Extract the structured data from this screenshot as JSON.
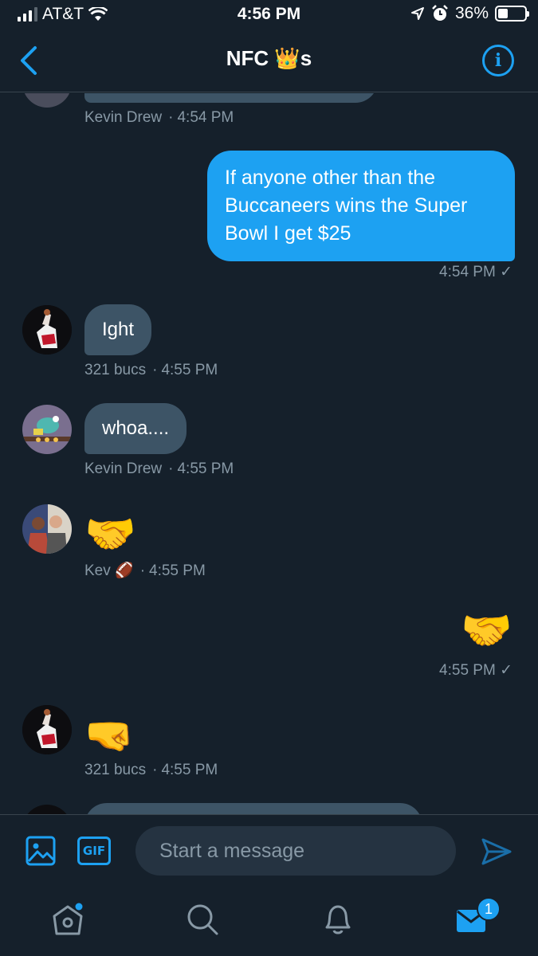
{
  "status_bar": {
    "carrier": "AT&T",
    "time": "4:56 PM",
    "battery": "36%",
    "battery_level": 0.36
  },
  "header": {
    "title": "NFC 👑s"
  },
  "messages": [
    {
      "author": "Kevin Drew",
      "time": "4:54 PM"
    },
    {
      "text": "If anyone other than the Buccaneers wins the Super Bowl I get $25",
      "time": "4:54 PM ✓"
    },
    {
      "text": "Ight",
      "author": "321 bucs",
      "time": "4:55 PM"
    },
    {
      "text": "whoa....",
      "author": "Kevin Drew",
      "time": "4:55 PM"
    },
    {
      "emoji": "🤝",
      "author": "Kev 🏈",
      "time": "4:55 PM"
    },
    {
      "emoji": "🤝",
      "time": "4:55 PM ✓"
    },
    {
      "emoji": "🤜",
      "author": "321 bucs",
      "time": "4:55 PM"
    }
  ],
  "composer": {
    "placeholder": "Start a message",
    "gif_label": "GIF"
  },
  "tabbar": {
    "messages_badge": "1"
  },
  "colors": {
    "background": "#15202b",
    "accent": "#1da1f2",
    "incoming_bubble": "#3d5466",
    "muted": "#8899a6"
  },
  "icons": [
    "back-chevron-icon",
    "info-icon",
    "image-icon",
    "gif-icon",
    "send-icon",
    "home-icon",
    "search-icon",
    "notifications-bell-icon",
    "messages-envelope-icon"
  ]
}
